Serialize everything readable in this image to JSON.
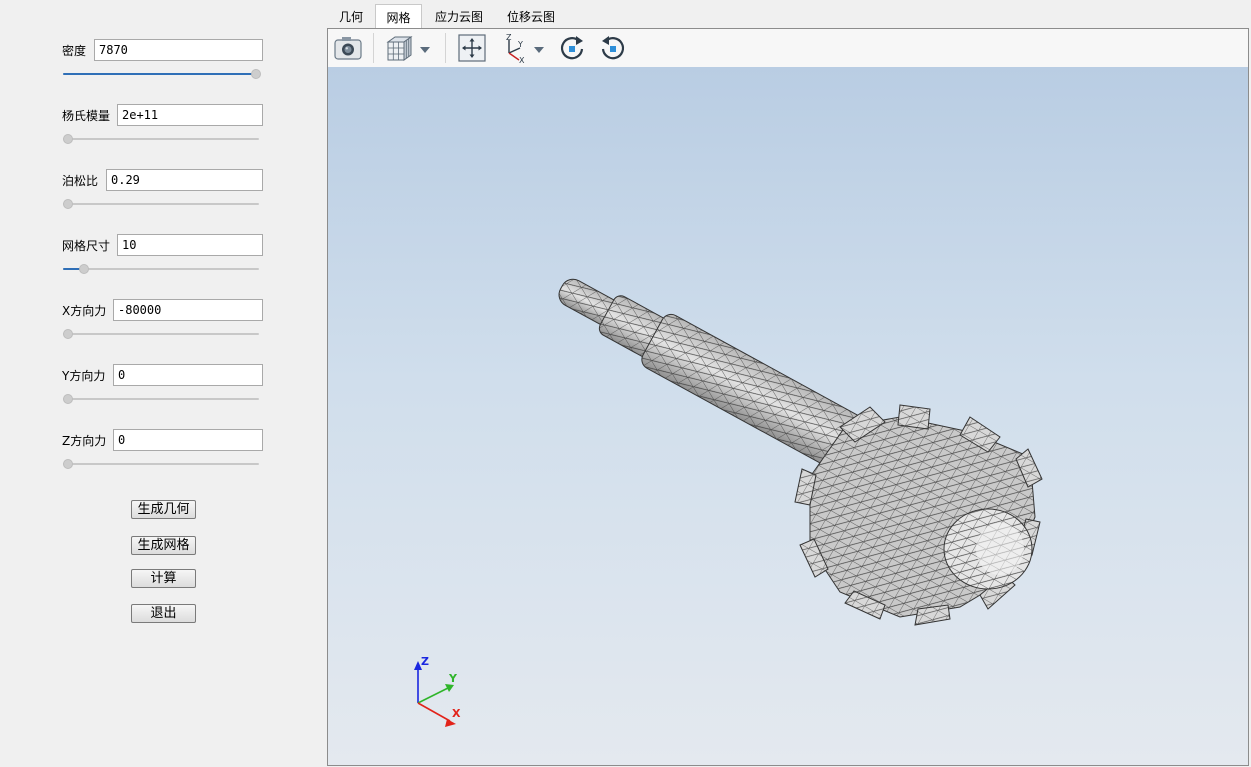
{
  "params": [
    {
      "label": "密度",
      "value": "7870",
      "fill": 1.0
    },
    {
      "label": "杨氏模量",
      "value": "2e+11",
      "fill": 0.0
    },
    {
      "label": "泊松比",
      "value": "0.29",
      "fill": 0.0
    },
    {
      "label": "网格尺寸",
      "value": "10",
      "fill": 0.09
    },
    {
      "label": "X方向力",
      "value": "-80000",
      "fill": 0.0
    },
    {
      "label": "Y方向力",
      "value": "0",
      "fill": 0.0
    },
    {
      "label": "Z方向力",
      "value": "0",
      "fill": 0.0
    }
  ],
  "buttons": {
    "generate_geometry": "生成几何",
    "generate_mesh": "生成网格",
    "compute": "计算",
    "exit": "退出"
  },
  "tabs": [
    {
      "label": "几何",
      "active": false
    },
    {
      "label": "网格",
      "active": true
    },
    {
      "label": "应力云图",
      "active": false
    },
    {
      "label": "位移云图",
      "active": false
    }
  ],
  "toolbar": {
    "icons": [
      "camera-icon",
      "view-cube-icon",
      "fit-all-icon",
      "axes-orientation-icon",
      "rotate-clockwise-icon",
      "rotate-counterclockwise-icon"
    ]
  },
  "triad": {
    "x": "X",
    "y": "Y",
    "z": "Z",
    "x_color": "#e2231a",
    "y_color": "#2fb52a",
    "z_color": "#1a27e0"
  },
  "colors": {
    "accent": "#2f6fb7",
    "viewport_top": "#b9cde3",
    "viewport_bottom": "#e4e9ef"
  }
}
